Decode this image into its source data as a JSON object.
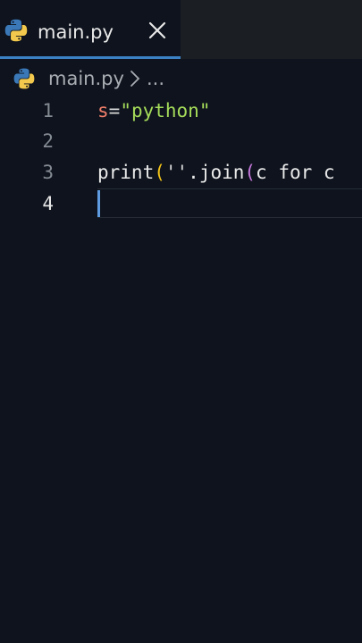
{
  "tab": {
    "label": "main.py",
    "icon": "python-icon",
    "close_icon": "close-icon",
    "accent": "#3b82c4"
  },
  "breadcrumb": {
    "file": "main.py",
    "separator_icon": "chevron-right-icon",
    "ellipsis": "..."
  },
  "editor": {
    "lines": [
      {
        "number": "1",
        "tokens": [
          {
            "text": "s",
            "kind": "var"
          },
          {
            "text": "=",
            "kind": "op"
          },
          {
            "text": "\"python\"",
            "kind": "str"
          }
        ]
      },
      {
        "number": "2",
        "tokens": []
      },
      {
        "number": "3",
        "tokens": [
          {
            "text": "print",
            "kind": "fn"
          },
          {
            "text": "(",
            "kind": "paren1"
          },
          {
            "text": "''",
            "kind": "op"
          },
          {
            "text": ".join",
            "kind": "fn"
          },
          {
            "text": "(",
            "kind": "paren2"
          },
          {
            "text": "c for c",
            "kind": "fn"
          }
        ]
      },
      {
        "number": "4",
        "tokens": [],
        "current": true
      }
    ],
    "colors": {
      "background": "#0e131d",
      "variable": "#f07e6a",
      "string": "#a6dc5a",
      "paren_level1": "#f5c518",
      "paren_level2": "#c678dd",
      "cursor": "#5e9be0"
    }
  }
}
